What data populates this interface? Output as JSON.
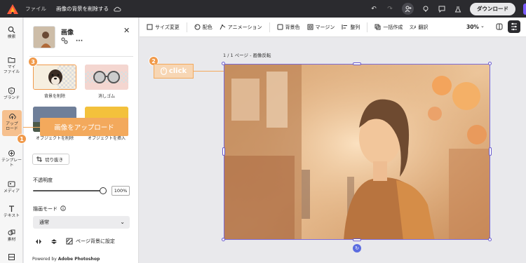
{
  "topbar": {
    "file_label": "ファイル",
    "doc_title": "画像の背景を削除する",
    "download_label": "ダウンロード"
  },
  "rail": {
    "items": [
      {
        "label": "検索",
        "icon": "search-icon"
      },
      {
        "label": "マイ\nファイル",
        "icon": "folder-icon"
      },
      {
        "label": "ブランド",
        "icon": "brand-icon"
      },
      {
        "label": "アップ\nロード",
        "icon": "upload-icon"
      },
      {
        "label": "テンプレート",
        "icon": "template-icon"
      },
      {
        "label": "メディア",
        "icon": "media-icon"
      },
      {
        "label": "テキスト",
        "icon": "text-icon"
      },
      {
        "label": "素材",
        "icon": "elements-icon"
      }
    ]
  },
  "panel": {
    "title": "画像",
    "cards": [
      {
        "label": "背景を削除"
      },
      {
        "label": "消しゴム"
      },
      {
        "label": "オブジェクトを削除"
      },
      {
        "label": "オブジェクトを挿入"
      }
    ],
    "crop_label": "切り抜き",
    "opacity_label": "不透明度",
    "opacity_value": "100%",
    "opacity_fraction": 1.0,
    "blend_label": "描画モード",
    "blend_value": "通常",
    "page_bg_label": "ページ背景に設定",
    "powered_prefix": "Powered by ",
    "powered_brand": "Adobe Photoshop"
  },
  "tooltip": {
    "text": "画像をアップロード"
  },
  "badges": {
    "one": "1",
    "two": "2",
    "three": "3"
  },
  "click_tag": {
    "text": "click"
  },
  "toolbar": {
    "tools": [
      {
        "label": "サイズ変更",
        "icon": "resize-icon"
      },
      {
        "label": "配色",
        "icon": "palette-icon"
      },
      {
        "label": "アニメーション",
        "icon": "animation-icon"
      },
      {
        "label": "背景色",
        "icon": "square-icon"
      },
      {
        "label": "マージン",
        "icon": "margin-icon"
      },
      {
        "label": "整列",
        "icon": "align-icon"
      },
      {
        "label": "一括作成",
        "icon": "bulk-icon"
      },
      {
        "label": "翻訳",
        "icon": "translate-icon"
      }
    ],
    "zoom": "30%"
  },
  "canvas": {
    "page_label": "1 / 1 ページ - 画像反転"
  },
  "colors": {
    "accent_orange": "#f3a95c",
    "selection_purple": "#6a5bd0",
    "topbar_bg": "#2b2b2f"
  }
}
